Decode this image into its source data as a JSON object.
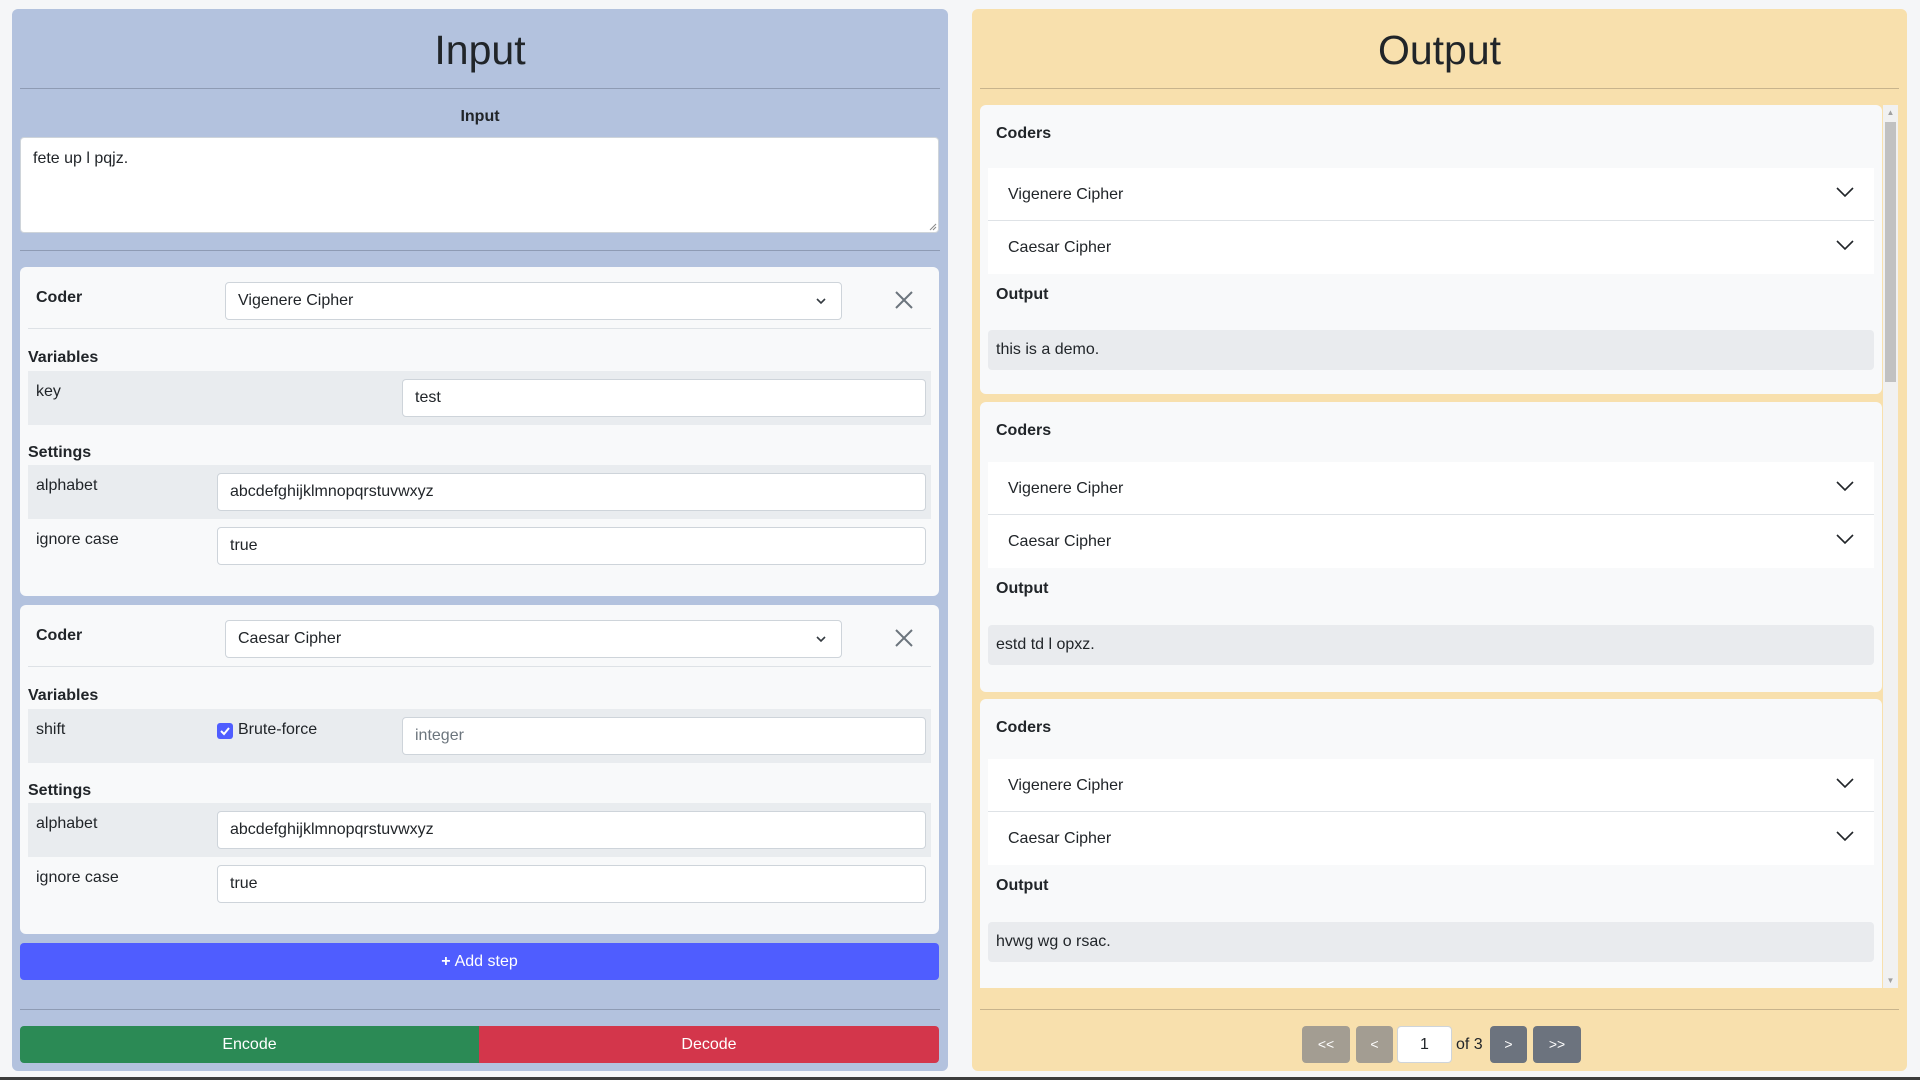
{
  "input_panel": {
    "title": "Input",
    "input_label": "Input",
    "input_text": "fete up l pqjz.",
    "steps": [
      {
        "coder_label": "Coder",
        "coder_value": "Vigenere Cipher",
        "variables_title": "Variables",
        "variables": [
          {
            "name": "key",
            "value": "test"
          }
        ],
        "settings_title": "Settings",
        "settings": [
          {
            "name": "alphabet",
            "value": "abcdefghijklmnopqrstuvwxyz"
          },
          {
            "name": "ignore case",
            "value": "true"
          }
        ]
      },
      {
        "coder_label": "Coder",
        "coder_value": "Caesar Cipher",
        "variables_title": "Variables",
        "variables": [
          {
            "name": "shift",
            "brute_force_label": "Brute-force",
            "brute_force_checked": true,
            "value": "",
            "placeholder": "integer"
          }
        ],
        "settings_title": "Settings",
        "settings": [
          {
            "name": "alphabet",
            "value": "abcdefghijklmnopqrstuvwxyz"
          },
          {
            "name": "ignore case",
            "value": "true"
          }
        ]
      }
    ],
    "add_step_label": "Add step",
    "encode_label": "Encode",
    "decode_label": "Decode"
  },
  "output_panel": {
    "title": "Output",
    "results": [
      {
        "coders_title": "Coders",
        "coders": [
          "Vigenere Cipher",
          "Caesar Cipher"
        ],
        "output_title": "Output",
        "output_text": "this is a demo."
      },
      {
        "coders_title": "Coders",
        "coders": [
          "Vigenere Cipher",
          "Caesar Cipher"
        ],
        "output_title": "Output",
        "output_text": "estd td l opxz."
      },
      {
        "coders_title": "Coders",
        "coders": [
          "Vigenere Cipher",
          "Caesar Cipher"
        ],
        "output_title": "Output",
        "output_text": "hvwg wg o rsac."
      }
    ],
    "pagination": {
      "first_label": "<<",
      "prev_label": "<",
      "current_page": "1",
      "of_label": "of 3",
      "next_label": ">",
      "last_label": ">>"
    }
  },
  "colors": {
    "input_bg": "#b3c2de",
    "output_bg": "#f8e0ad",
    "add_step": "#4f5dff",
    "encode": "#2b8a55",
    "decode": "#d3364b"
  }
}
